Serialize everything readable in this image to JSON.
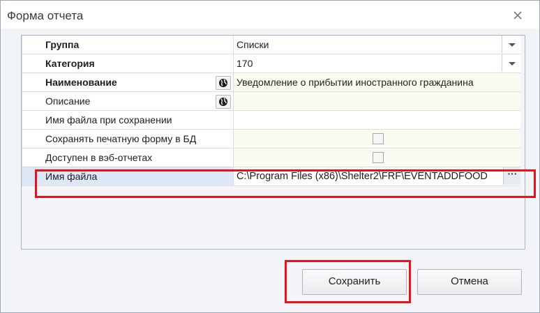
{
  "window": {
    "title": "Форма отчета"
  },
  "grid": {
    "rows": [
      {
        "label": "Группа",
        "bold": true,
        "value": "Списки",
        "editor": "dropdown"
      },
      {
        "label": "Категория",
        "bold": true,
        "value": "170",
        "editor": "dropdown"
      },
      {
        "label": "Наименование",
        "bold": true,
        "value": "Уведомление о прибытии иностранного гражданина",
        "editor": "text",
        "globe": true
      },
      {
        "label": "Описание",
        "bold": false,
        "value": "",
        "editor": "text",
        "globe": true
      },
      {
        "label": "Имя файла при сохранении",
        "bold": false,
        "value": "",
        "editor": "text"
      },
      {
        "label": "Сохранять печатную форму в БД",
        "bold": false,
        "value": "",
        "editor": "checkbox",
        "checked": false
      },
      {
        "label": "Доступен в вэб-отчетах",
        "bold": false,
        "value": "",
        "editor": "checkbox",
        "checked": false
      },
      {
        "label": "Имя файла",
        "bold": false,
        "value": "C:\\Program Files (x86)\\Shelter2\\FRF\\EVENTADDFOOD",
        "editor": "file",
        "ellipsis": "···"
      }
    ]
  },
  "buttons": {
    "save": "Сохранить",
    "cancel": "Отмена"
  },
  "colors": {
    "highlight": "#e8121c",
    "selected_row": "#dfe8f6"
  },
  "icons": {
    "close": "close-icon",
    "globe": "globe-icon",
    "dropdown": "chevron-down-icon"
  }
}
